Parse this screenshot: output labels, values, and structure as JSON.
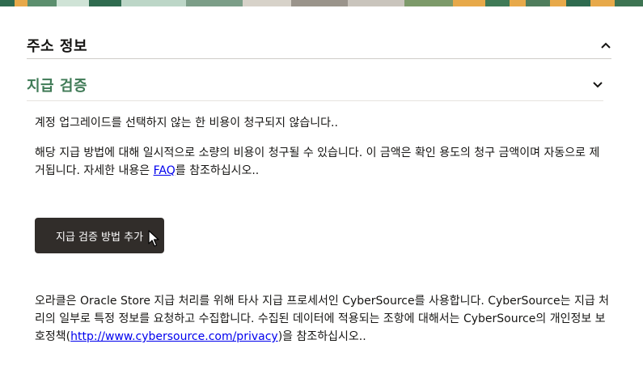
{
  "address_section": {
    "title": "주소 정보",
    "toggle_icon": "chevron-up-icon"
  },
  "payment_section": {
    "title": "지급 검증",
    "toggle_icon": "chevron-down-icon",
    "notice_1": "계정 업그레이드를 선택하지 않는 한 비용이 청구되지 않습니다..",
    "notice_2_before": "해당 지급 방법에 대해 일시적으로 소량의 비용이 청구될 수 있습니다. 이 금액은 확인 용도의 청구 금액이며 자동으로 제거됩니다. 자세한 내용은 ",
    "notice_2_link": "FAQ",
    "notice_2_after": "를 참조하십시오..",
    "add_button_label": "지급 검증 방법 추가",
    "processor_before": "오라클은 Oracle Store 지급 처리를 위해 타사 지급 프로세서인 CyberSource를 사용합니다. CyberSource는 지급 처리의 일부로 특정 정보를 요청하고 수집합니다. 수집된 데이터에 적용되는 조항에 대해서는 CyberSource의 개인정보 보호정책(",
    "processor_link": "http://www.cybersource.com/privacy",
    "processor_after": ")을 참조하십시오.."
  },
  "colors": {
    "accent_green": "#3f7a56",
    "button_bg": "#312d2a",
    "link": "#0000ee"
  }
}
